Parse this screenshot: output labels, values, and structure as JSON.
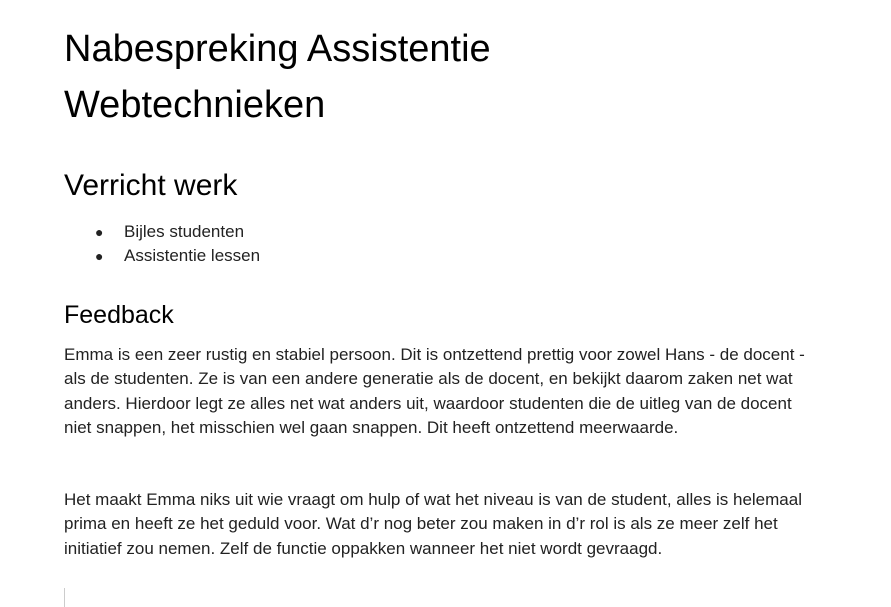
{
  "document": {
    "title": "Nabespreking Assistentie Webtechnieken",
    "section1": {
      "heading": "Verricht werk",
      "bullets": [
        "Bijles studenten",
        "Assistentie lessen"
      ]
    },
    "section2": {
      "heading": "Feedback",
      "paragraphs": [
        "Emma is een zeer rustig en stabiel persoon. Dit is ontzettend prettig voor zowel Hans - de docent - als de studenten. Ze is van een andere generatie als de docent, en bekijkt daarom zaken net wat anders. Hierdoor legt ze alles net wat anders uit, waardoor studenten die de uitleg van de docent niet snappen, het misschien wel gaan snappen. Dit heeft ontzettend meerwaarde.",
        "Het maakt Emma niks uit wie vraagt om hulp of wat het niveau is van de student, alles is helemaal prima en heeft ze het geduld voor. Wat d’r nog beter zou maken in d’r rol is als ze meer zelf het initiatief zou nemen. Zelf de functie oppakken wanneer het niet wordt gevraagd."
      ]
    }
  }
}
